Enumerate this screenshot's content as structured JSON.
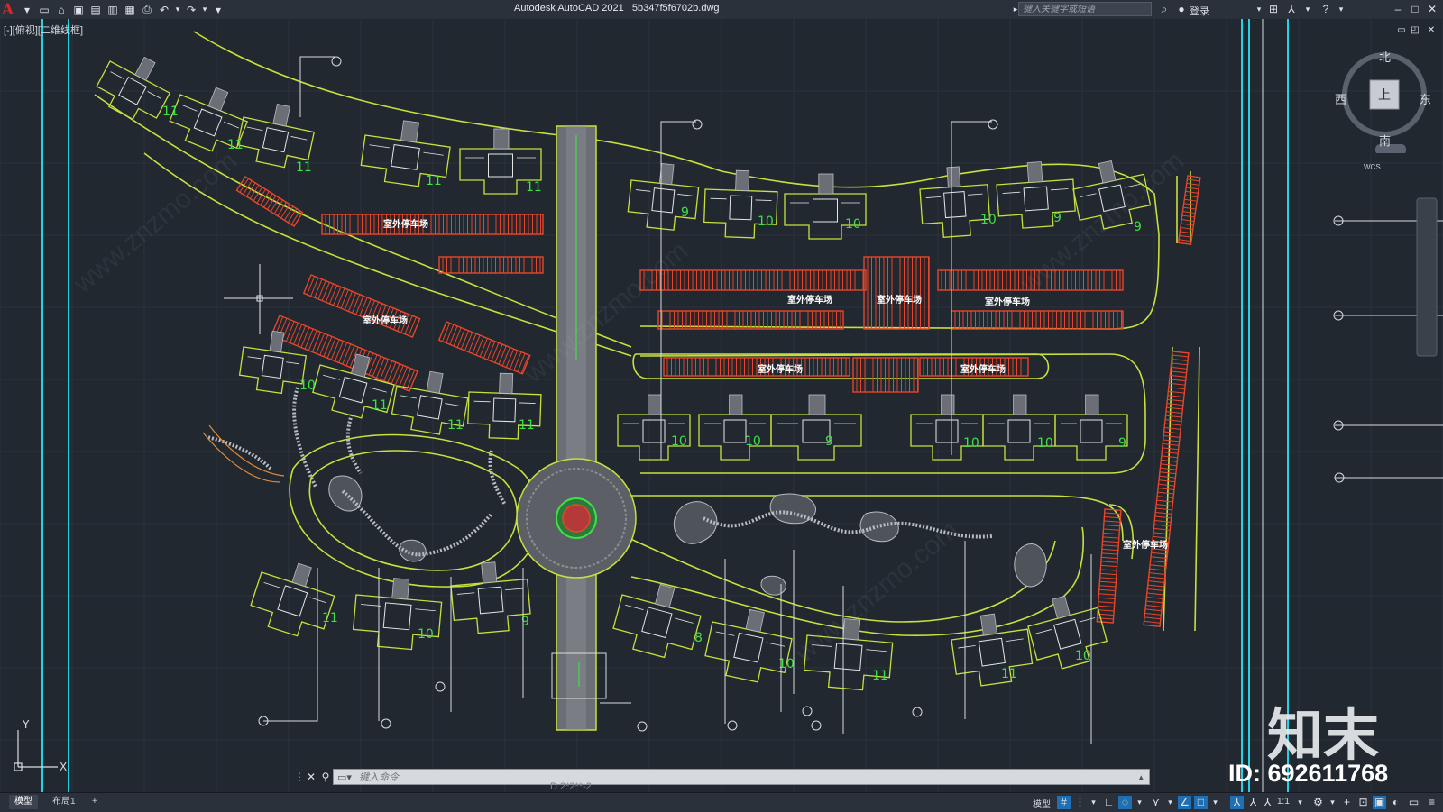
{
  "app": {
    "title": "Autodesk AutoCAD 2021",
    "filename": "5b347f5f6702b.dwg",
    "logo": "A"
  },
  "titlebar": {
    "search_placeholder": "键入关键字或短语",
    "signin_label": "登录",
    "icons": [
      "new-icon",
      "open-icon",
      "save-icon",
      "saveas-icon",
      "publish-icon",
      "plot-icon",
      "print-icon",
      "undo-icon",
      "redo-icon",
      "customize-icon"
    ]
  },
  "viewport": {
    "label": "[-][俯视][二维线框]"
  },
  "drawing": {
    "parking_labels": [
      "室外停车场",
      "室外停车场",
      "室外停车场",
      "室外停车场",
      "室外停车场",
      "室外停车场",
      "室外停车场",
      "室外停车场"
    ],
    "floor_counts": [
      "11",
      "11",
      "11",
      "11",
      "11",
      "9",
      "10",
      "10",
      "10",
      "9",
      "9",
      "10",
      "11",
      "11",
      "11",
      "10",
      "10",
      "9",
      "10",
      "10",
      "9",
      "11",
      "10",
      "9",
      "8",
      "10",
      "11",
      "11",
      "10"
    ],
    "axis_x": "X",
    "axis_y": "Y"
  },
  "viewcube": {
    "north": "北",
    "south": "南",
    "east": "东",
    "west": "西",
    "face": "上",
    "wcs": "WCS"
  },
  "command": {
    "placeholder": "键入命令",
    "residue": "D:2*2**-2"
  },
  "status": {
    "tabs": [
      "模型",
      "布局1",
      "+"
    ],
    "model_label": "模型",
    "scale": "1:1"
  },
  "watermark": {
    "brand": "知末",
    "id": "ID: 692611768"
  },
  "colors": {
    "background": "#212830",
    "road": "#c8e03c",
    "parking": "#e8452a",
    "number": "#3fe046",
    "building": "#e6e6e6",
    "cyan_line": "#22d3e6"
  }
}
